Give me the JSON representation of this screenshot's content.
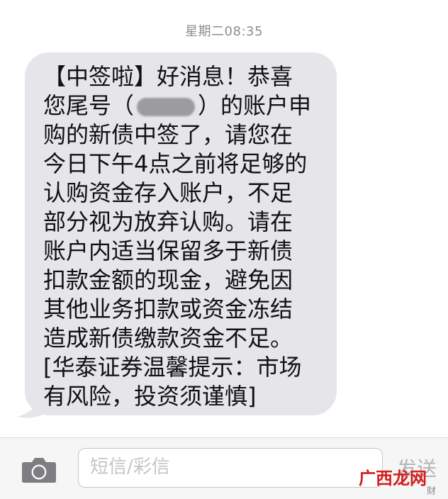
{
  "header": {
    "timestamp": "星期二08:35"
  },
  "message": {
    "lines": [
      "【中签啦】好消息！恭喜",
      "购的新债中签了，请您在",
      "今日下午4点之前将足够的",
      "认购资金存入账户，不足",
      "部分视为放弃认购。请在",
      "账户内适当保留多于新债",
      "扣款金额的现金，避免因",
      "其他业务扣款或资金冻结",
      "造成新债缴款资金不足。",
      "[华泰证券温馨提示：市场",
      "有风险，投资须谨慎]"
    ],
    "line2_before": "您尾号（",
    "line2_after": "）的账户申"
  },
  "input_bar": {
    "placeholder": "短信/彩信",
    "send_label": "发送"
  },
  "watermark": {
    "text": "广西龙网",
    "small": "财"
  },
  "icons": {
    "camera": "camera-icon"
  },
  "colors": {
    "bubble": "#e5e5ea",
    "timestamp": "#8e8e93",
    "send_disabled": "#b5b5ba",
    "watermark": "#d21d1d"
  }
}
